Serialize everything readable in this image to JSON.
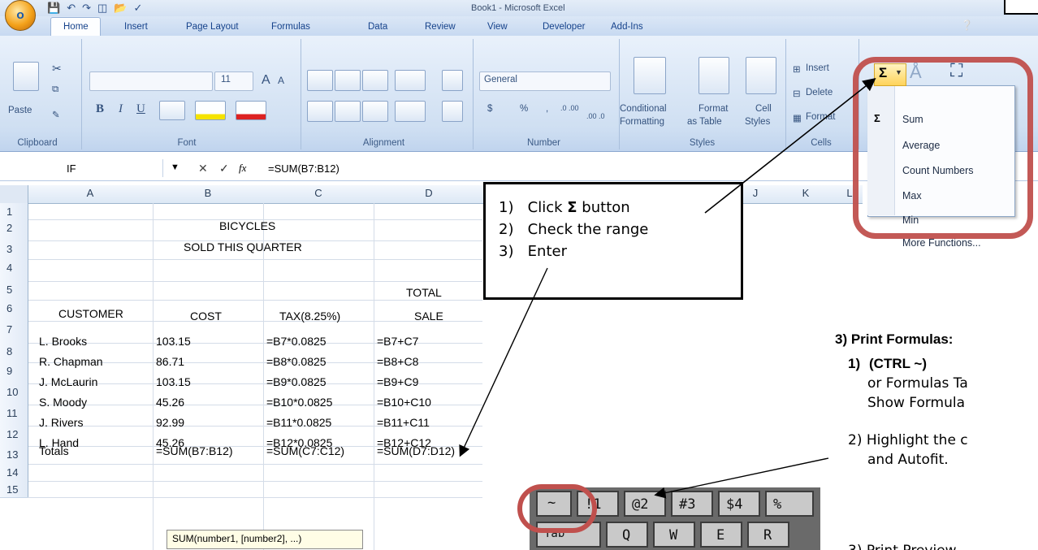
{
  "window": {
    "title": "Book1 - Microsoft Excel",
    "office_button_label": "O"
  },
  "tabs": [
    "Home",
    "Insert",
    "Page Layout",
    "Formulas",
    "Data",
    "Review",
    "View",
    "Developer",
    "Add-Ins"
  ],
  "ribbon": {
    "clipboard": {
      "label": "Clipboard",
      "paste": "Paste"
    },
    "font": {
      "label": "Font",
      "size": "11",
      "grow": "A",
      "shrink": "A",
      "bold": "B",
      "italic": "I",
      "underline": "U"
    },
    "alignment": {
      "label": "Alignment"
    },
    "number": {
      "label": "Number",
      "format": "General",
      "currency": "$",
      "percent": "%",
      "comma": ",",
      "inc_decimal": ".0 .00",
      "dec_decimal": ".00 .0"
    },
    "styles": {
      "label": "Styles",
      "conditional": "Conditional",
      "conditional2": "Formatting",
      "format_table": "Format",
      "format_table2": "as Table",
      "cell_styles": "Cell",
      "cell_styles2": "Styles"
    },
    "cells": {
      "label": "Cells",
      "insert": "Insert",
      "delete": "Delete",
      "format": "Format"
    },
    "editing": {
      "sum_symbol": "Σ"
    }
  },
  "autosum_menu": [
    "Sum",
    "Average",
    "Count Numbers",
    "Max",
    "Min",
    "More Functions..."
  ],
  "formula_bar": {
    "name_box": "IF",
    "cancel": "✕",
    "enter": "✓",
    "fx": "fx",
    "formula": "=SUM(B7:B12)"
  },
  "columns": [
    "A",
    "B",
    "C",
    "D",
    "J",
    "K",
    "L"
  ],
  "rows": [
    "1",
    "2",
    "3",
    "4",
    "5",
    "6",
    "7",
    "8",
    "9",
    "10",
    "11",
    "12",
    "13",
    "14",
    "15"
  ],
  "sheet": {
    "title1": "BICYCLES",
    "title2": "SOLD THIS QUARTER",
    "total_label": "TOTAL",
    "headers": [
      "CUSTOMER",
      "COST",
      "TAX(8.25%)",
      "SALE"
    ],
    "data": [
      [
        "L. Brooks",
        "103.15",
        "=B7*0.0825",
        "=B7+C7"
      ],
      [
        "R. Chapman",
        "86.71",
        "=B8*0.0825",
        "=B8+C8"
      ],
      [
        "J. McLaurin",
        "103.15",
        "=B9*0.0825",
        "=B9+C9"
      ],
      [
        "S. Moody",
        "45.26",
        "=B10*0.0825",
        "=B10+C10"
      ],
      [
        "J. Rivers",
        "92.99",
        "=B11*0.0825",
        "=B11+C11"
      ],
      [
        "L. Hand",
        "45.26",
        "=B12*0.0825",
        "=B12+C12"
      ]
    ],
    "totals": [
      "Totals",
      "=SUM(B7:B12)",
      "=SUM(C7:C12)",
      "=SUM(D7:D12)"
    ],
    "tooltip": "SUM(number1, [number2], ...)"
  },
  "callout": {
    "steps": [
      {
        "num": "1)",
        "pre": "Click ",
        "bold": "Σ",
        "post": " button"
      },
      {
        "num": "2)",
        "pre": "Check the range",
        "bold": "",
        "post": ""
      },
      {
        "num": "3)",
        "pre": "Enter",
        "bold": "",
        "post": ""
      }
    ]
  },
  "print_formulas": {
    "heading": "3)  Print Formulas:",
    "step1_num": "1)",
    "step1_key": "(CTRL ~)",
    "step1_line2": "or Formulas Ta",
    "step1_line3": "Show Formula",
    "step2_line1": "2)  Highlight the c",
    "step2_line2": "and Autofit.",
    "step3_partial": "3)  Print Preview"
  },
  "keyboard": {
    "row1": [
      "~",
      "!1",
      "@2",
      "#3",
      "$4",
      "%"
    ],
    "row2": [
      "Tab",
      "Q",
      "W",
      "E",
      "R"
    ]
  },
  "colors": {
    "ribbon_blue": "#15428b",
    "callout_ring": "#c0504d"
  }
}
